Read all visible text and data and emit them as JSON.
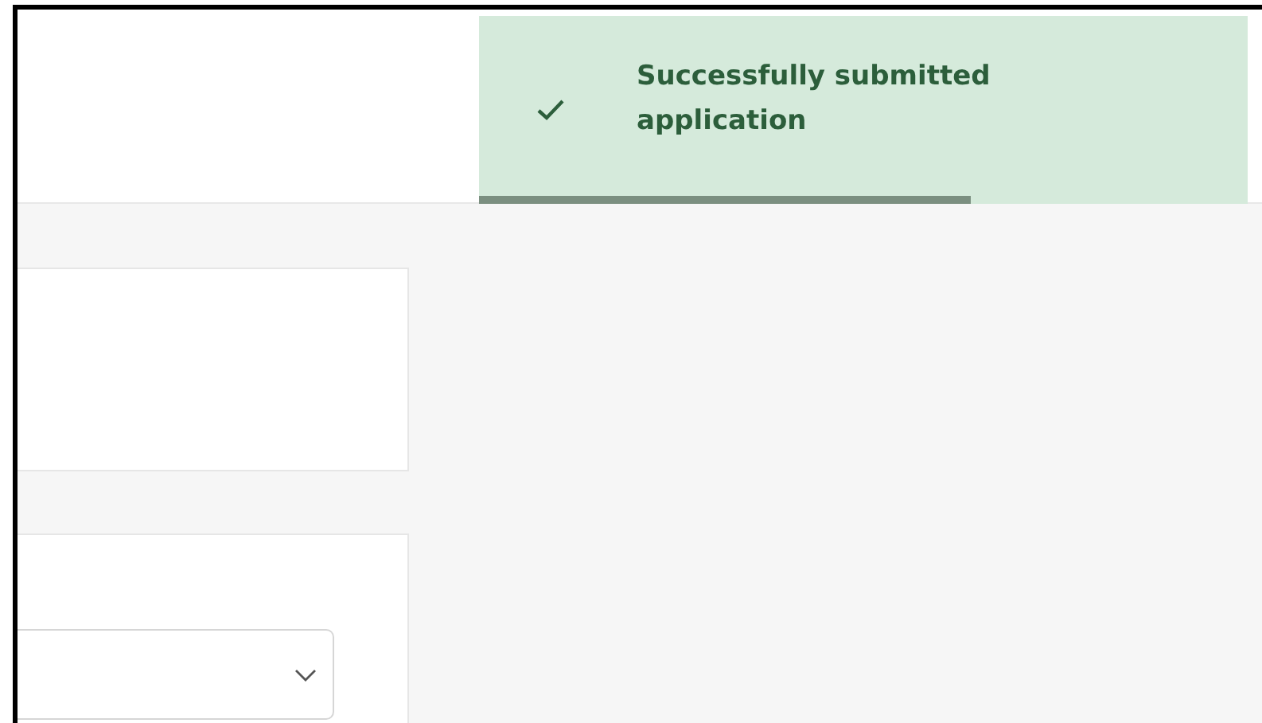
{
  "toast": {
    "kind": "success",
    "message": "Successfully submitted application",
    "level": 0.64
  }
}
